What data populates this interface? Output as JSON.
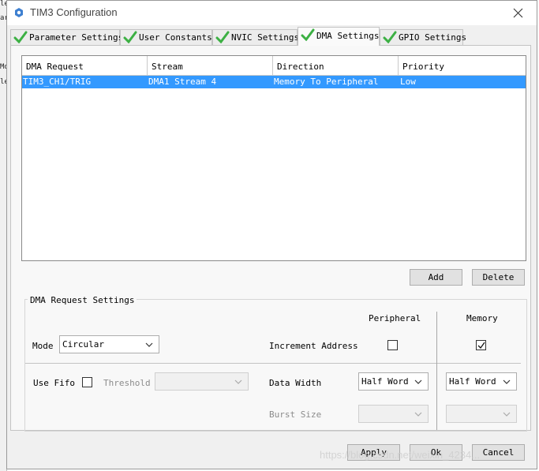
{
  "window": {
    "title": "TIM3 Configuration"
  },
  "background_fragments": [
    "le",
    "ar",
    "Mo",
    "le"
  ],
  "tabs": [
    {
      "label": "Parameter Settings",
      "active": false
    },
    {
      "label": "User Constants",
      "active": false
    },
    {
      "label": "NVIC Settings",
      "active": false
    },
    {
      "label": "DMA Settings",
      "active": true
    },
    {
      "label": "GPIO Settings",
      "active": false
    }
  ],
  "dma_table": {
    "columns": [
      "DMA Request",
      "Stream",
      "Direction",
      "Priority"
    ],
    "rows": [
      {
        "request": "TIM3_CH1/TRIG",
        "stream": "DMA1 Stream 4",
        "direction": "Memory To Peripheral",
        "priority": "Low",
        "selected": true
      }
    ]
  },
  "actions": {
    "add": "Add",
    "delete": "Delete"
  },
  "request_settings": {
    "title": "DMA Request Settings",
    "peripheral_header": "Peripheral",
    "memory_header": "Memory",
    "mode_label": "Mode",
    "mode_value": "Circular",
    "increment_label": "Increment Address",
    "increment_peripheral": false,
    "increment_memory": true,
    "fifo_label": "Use Fifo",
    "fifo_checked": false,
    "threshold_label": "Threshold",
    "threshold_value": "",
    "data_width_label": "Data Width",
    "data_width_peripheral": "Half Word",
    "data_width_memory": "Half Word",
    "burst_label": "Burst Size",
    "burst_peripheral": "",
    "burst_memory": ""
  },
  "footer": {
    "apply": "Apply",
    "ok": "Ok",
    "cancel": "Cancel"
  },
  "watermark": "https://blog.csdn.net/weixin_4234...",
  "colors": {
    "selection": "#3399ff",
    "check_green": "#3cb043"
  }
}
